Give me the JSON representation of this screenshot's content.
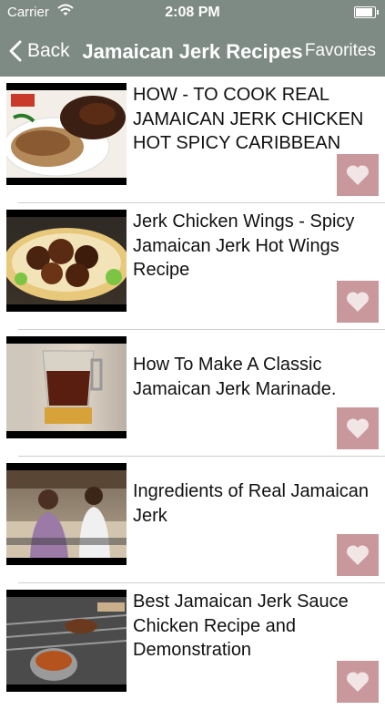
{
  "status_bar": {
    "carrier": "Carrier",
    "time": "2:08 PM",
    "battery_level": 1.0
  },
  "nav": {
    "back_label": "Back",
    "title": "Jamaican Jerk Recipes",
    "favorites_label": "Favorites",
    "bar_color": "#7e8a84"
  },
  "videos": [
    {
      "title": "HOW - TO COOK REAL JAMAICAN JERK CHICKEN HOT SPICY CARIBBEAN MEAL RECI...",
      "thumbnail_icon": "jerk-chicken-rice-plate"
    },
    {
      "title": "Jerk Chicken Wings - Spicy Jamaican Jerk Hot Wings Recipe",
      "thumbnail_icon": "jerk-wings-plate"
    },
    {
      "title": "How To Make A Classic Jamaican Jerk Marinade.",
      "thumbnail_icon": "blender-marinade"
    },
    {
      "title": "Ingredients of Real Jamaican Jerk",
      "thumbnail_icon": "kitchen-hosts"
    },
    {
      "title": "Best Jamaican Jerk Sauce Chicken Recipe and Demonstration",
      "thumbnail_icon": "grill-pot"
    }
  ],
  "favorite_icon": "heart-icon",
  "favorite_button_color": "#c9989d"
}
